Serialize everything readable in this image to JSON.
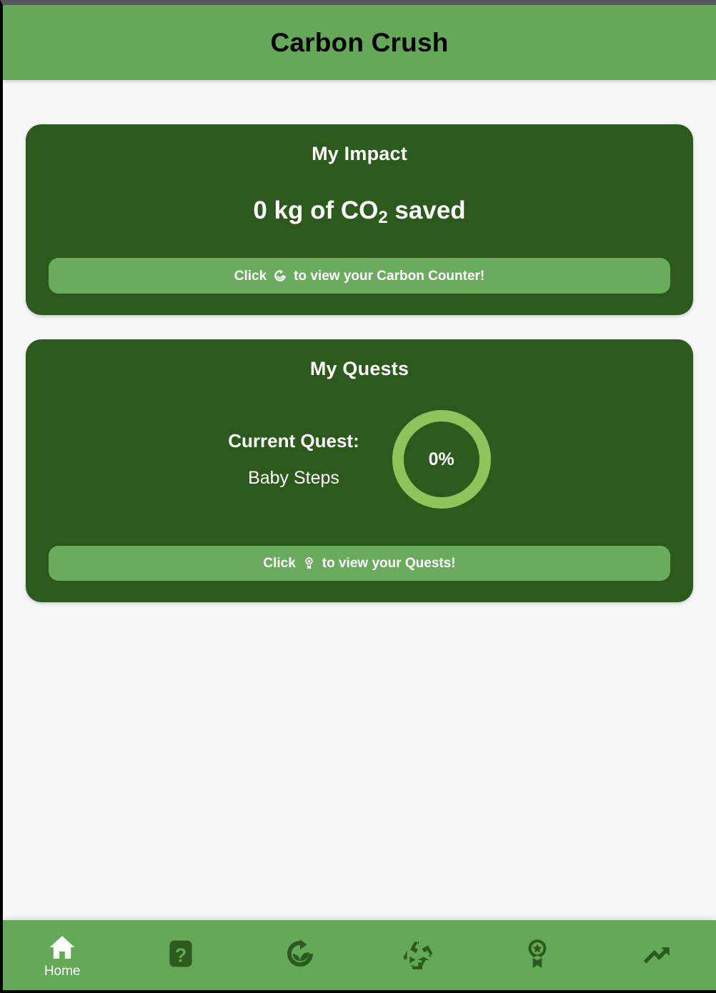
{
  "header": {
    "title": "Carbon Crush"
  },
  "impact_card": {
    "title": "My Impact",
    "value_prefix": "0 kg of CO",
    "value_sub": "2",
    "value_suffix": " saved",
    "button_prefix": "Click",
    "button_icon": "leaf-recycle-icon",
    "button_suffix": "to view your Carbon Counter!"
  },
  "quests_card": {
    "title": "My Quests",
    "current_quest_label": "Current Quest:",
    "current_quest_name": "Baby Steps",
    "progress_percent": "0%",
    "button_prefix": "Click",
    "button_icon": "award-badge-icon",
    "button_suffix": "to view your Quests!"
  },
  "bottom_nav": {
    "items": [
      {
        "icon": "home-icon",
        "label": "Home",
        "active": true
      },
      {
        "icon": "question-mark-icon",
        "label": "",
        "active": false
      },
      {
        "icon": "leaf-recycle-icon",
        "label": "",
        "active": false
      },
      {
        "icon": "recycle-icon",
        "label": "",
        "active": false
      },
      {
        "icon": "award-badge-icon",
        "label": "",
        "active": false
      },
      {
        "icon": "trending-up-icon",
        "label": "",
        "active": false
      }
    ]
  },
  "colors": {
    "header_green": "#63a958",
    "card_dark_green": "#2b5a1c",
    "button_green": "#6bab5e",
    "ring_light_green": "#8ec45b",
    "page_background": "#f7f7f7",
    "nav_icon_dark": "#2b5a1c",
    "text_white": "#ffffff"
  }
}
